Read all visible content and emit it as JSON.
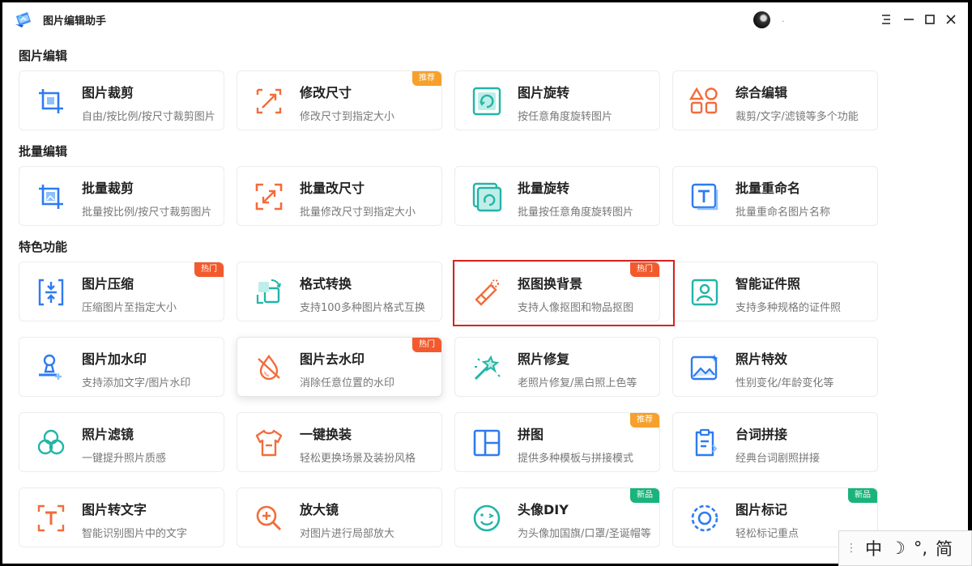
{
  "window": {
    "title": "图片编辑助手"
  },
  "sections": [
    {
      "title": "图片编辑"
    },
    {
      "title": "批量编辑"
    },
    {
      "title": "特色功能"
    }
  ],
  "cards": [
    {
      "title": "图片裁剪",
      "desc": "自由/按比例/按尺寸裁剪图片",
      "icon": "crop-icon",
      "badge": ""
    },
    {
      "title": "修改尺寸",
      "desc": "修改尺寸到指定大小",
      "icon": "resize-icon",
      "badge": "推荐"
    },
    {
      "title": "图片旋转",
      "desc": "按任意角度旋转图片",
      "icon": "rotate-icon",
      "badge": ""
    },
    {
      "title": "综合编辑",
      "desc": "裁剪/文字/滤镜等多个功能",
      "icon": "shapes-icon",
      "badge": ""
    },
    {
      "title": "批量裁剪",
      "desc": "批量按比例/按尺寸裁剪图片",
      "icon": "batch-crop-icon",
      "badge": ""
    },
    {
      "title": "批量改尺寸",
      "desc": "批量修改尺寸到指定大小",
      "icon": "batch-resize-icon",
      "badge": ""
    },
    {
      "title": "批量旋转",
      "desc": "批量按任意角度旋转图片",
      "icon": "batch-rotate-icon",
      "badge": ""
    },
    {
      "title": "批量重命名",
      "desc": "批量重命名图片名称",
      "icon": "rename-icon",
      "badge": ""
    },
    {
      "title": "图片压缩",
      "desc": "压缩图片至指定大小",
      "icon": "compress-icon",
      "badge": "热门"
    },
    {
      "title": "格式转换",
      "desc": "支持100多种图片格式互换",
      "icon": "convert-icon",
      "badge": ""
    },
    {
      "title": "抠图换背景",
      "desc": "支持人像抠图和物品抠图",
      "icon": "cutout-icon",
      "badge": "热门"
    },
    {
      "title": "智能证件照",
      "desc": "支持多种规格的证件照",
      "icon": "id-photo-icon",
      "badge": ""
    },
    {
      "title": "图片加水印",
      "desc": "支持添加文字/图片水印",
      "icon": "stamp-icon",
      "badge": ""
    },
    {
      "title": "图片去水印",
      "desc": "消除任意位置的水印",
      "icon": "remove-watermark-icon",
      "badge": "热门"
    },
    {
      "title": "照片修复",
      "desc": "老照片修复/黑白照上色等",
      "icon": "magic-wand-icon",
      "badge": ""
    },
    {
      "title": "照片特效",
      "desc": "性别变化/年龄变化等",
      "icon": "effect-icon",
      "badge": ""
    },
    {
      "title": "照片滤镜",
      "desc": "一键提升照片质感",
      "icon": "filter-icon",
      "badge": ""
    },
    {
      "title": "一键换装",
      "desc": "轻松更换场景及装扮风格",
      "icon": "shirt-icon",
      "badge": ""
    },
    {
      "title": "拼图",
      "desc": "提供多种模板与拼接模式",
      "icon": "collage-icon",
      "badge": "推荐"
    },
    {
      "title": "台词拼接",
      "desc": "经典台词剧照拼接",
      "icon": "script-icon",
      "badge": ""
    },
    {
      "title": "图片转文字",
      "desc": "智能识别图片中的文字",
      "icon": "ocr-icon",
      "badge": ""
    },
    {
      "title": "放大镜",
      "desc": "对图片进行局部放大",
      "icon": "magnifier-icon",
      "badge": ""
    },
    {
      "title": "头像DIY",
      "desc": "为头像加国旗/口罩/圣诞帽等",
      "icon": "smiley-icon",
      "badge": "新品"
    },
    {
      "title": "图片标记",
      "desc": "轻松标记重点",
      "icon": "mark-icon",
      "badge": "新品"
    }
  ],
  "ime": {
    "lang": "中",
    "punct": "°,",
    "mode": "简"
  },
  "colors": {
    "blue": "#2e7bf0",
    "orange": "#f26c3c",
    "teal": "#22b5a8",
    "hot": "#f25a2d",
    "recommend": "#f7a02b",
    "new": "#1bb37c",
    "highlight": "#d6231f"
  }
}
